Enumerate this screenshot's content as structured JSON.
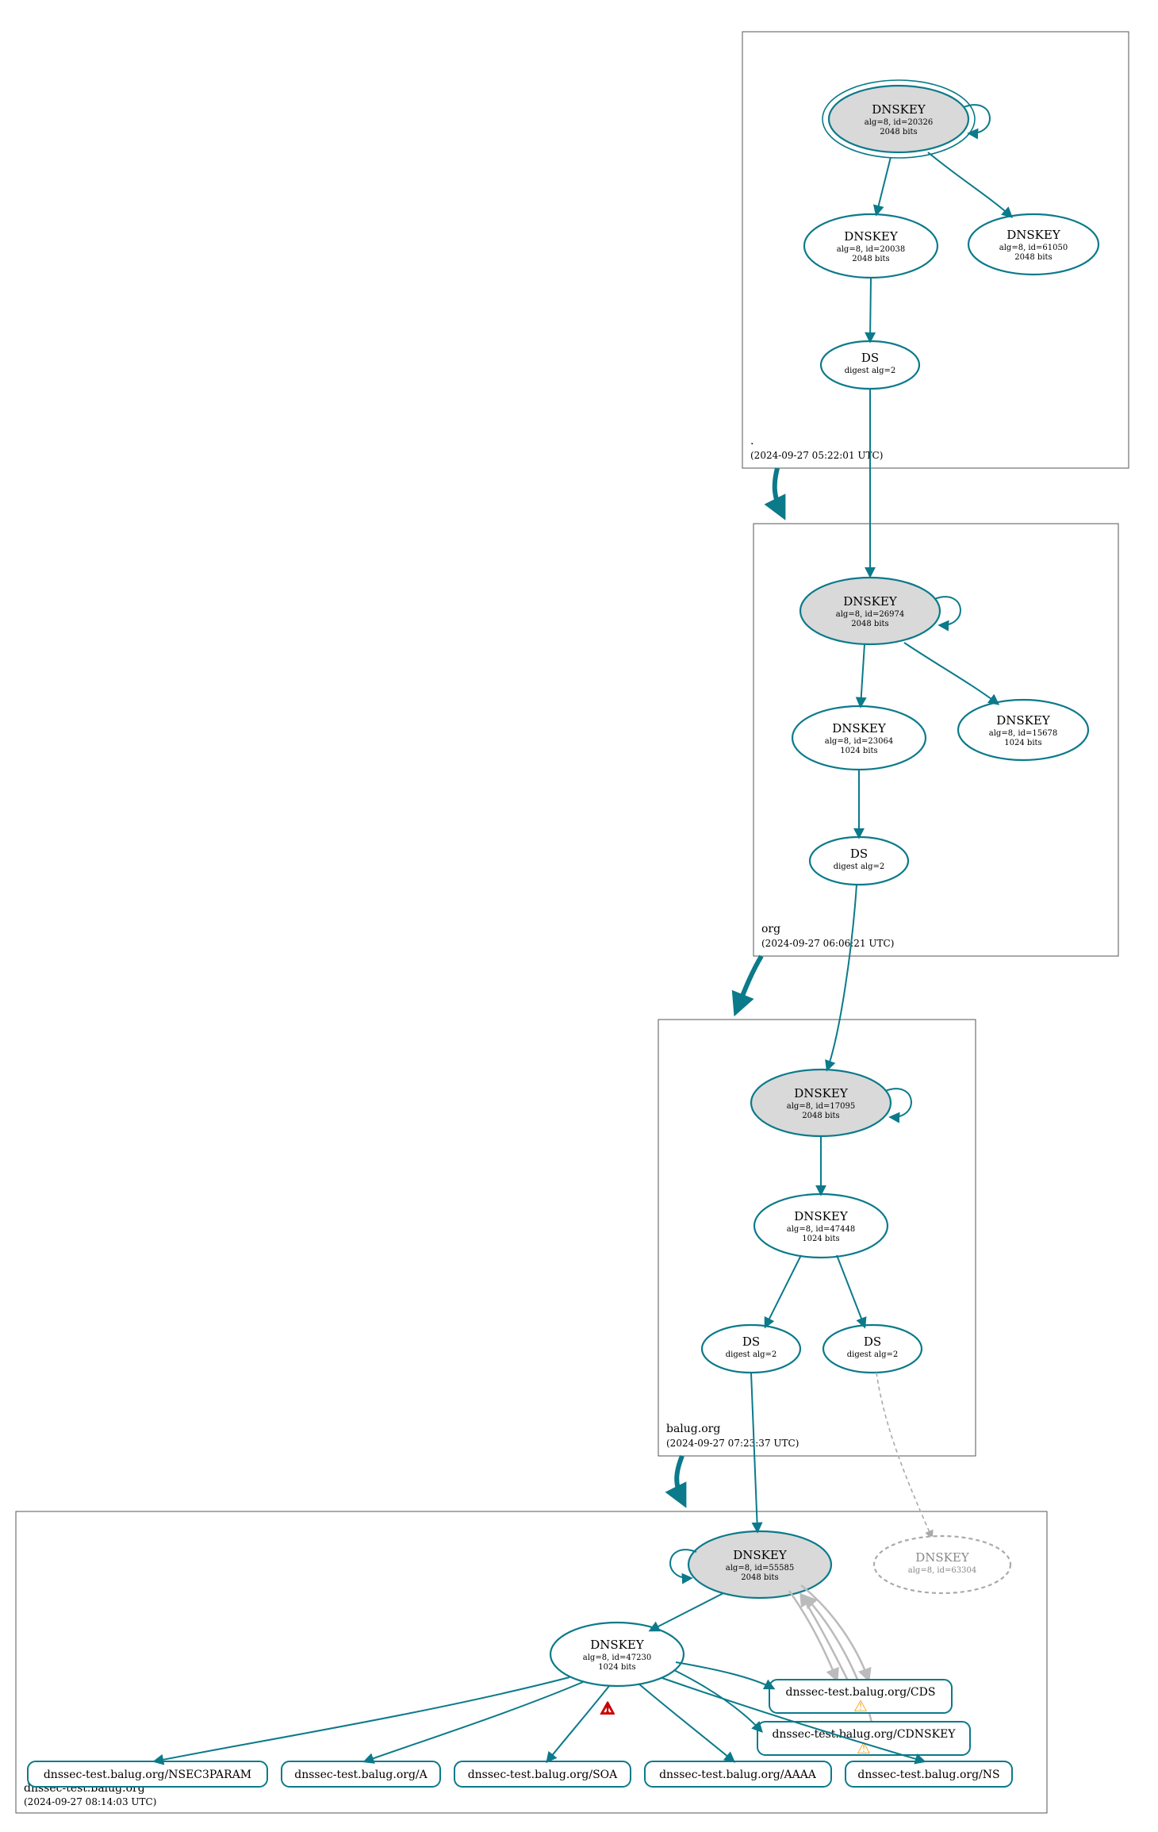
{
  "zone_root": {
    "label": ".",
    "timestamp": "(2024-09-27 05:22:01 UTC)",
    "ksk": {
      "title": "DNSKEY",
      "l2": "alg=8, id=20326",
      "l3": "2048 bits"
    },
    "zsk": {
      "title": "DNSKEY",
      "l2": "alg=8, id=20038",
      "l3": "2048 bits"
    },
    "zsk2": {
      "title": "DNSKEY",
      "l2": "alg=8, id=61050",
      "l3": "2048 bits"
    },
    "ds": {
      "title": "DS",
      "l2": "digest alg=2"
    }
  },
  "zone_org": {
    "label": "org",
    "timestamp": "(2024-09-27 06:06:21 UTC)",
    "ksk": {
      "title": "DNSKEY",
      "l2": "alg=8, id=26974",
      "l3": "2048 bits"
    },
    "zsk": {
      "title": "DNSKEY",
      "l2": "alg=8, id=23064",
      "l3": "1024 bits"
    },
    "zsk2": {
      "title": "DNSKEY",
      "l2": "alg=8, id=15678",
      "l3": "1024 bits"
    },
    "ds": {
      "title": "DS",
      "l2": "digest alg=2"
    }
  },
  "zone_balug": {
    "label": "balug.org",
    "timestamp": "(2024-09-27 07:23:37 UTC)",
    "ksk": {
      "title": "DNSKEY",
      "l2": "alg=8, id=17095",
      "l3": "2048 bits"
    },
    "zsk": {
      "title": "DNSKEY",
      "l2": "alg=8, id=47448",
      "l3": "1024 bits"
    },
    "ds1": {
      "title": "DS",
      "l2": "digest alg=2"
    },
    "ds2": {
      "title": "DS",
      "l2": "digest alg=2"
    }
  },
  "zone_dnssec": {
    "label": "dnssec-test.balug.org",
    "timestamp": "(2024-09-27 08:14:03 UTC)",
    "ksk": {
      "title": "DNSKEY",
      "l2": "alg=8, id=55585",
      "l3": "2048 bits"
    },
    "revoked": {
      "title": "DNSKEY",
      "l2": "alg=8, id=63304"
    },
    "zsk": {
      "title": "DNSKEY",
      "l2": "alg=8, id=47230",
      "l3": "1024 bits"
    },
    "rr_cds": {
      "label": "dnssec-test.balug.org/CDS"
    },
    "rr_cdnskey": {
      "label": "dnssec-test.balug.org/CDNSKEY"
    },
    "rr_nsec3": {
      "label": "dnssec-test.balug.org/NSEC3PARAM"
    },
    "rr_a": {
      "label": "dnssec-test.balug.org/A"
    },
    "rr_soa": {
      "label": "dnssec-test.balug.org/SOA"
    },
    "rr_aaaa": {
      "label": "dnssec-test.balug.org/AAAA"
    },
    "rr_ns": {
      "label": "dnssec-test.balug.org/NS"
    }
  },
  "colors": {
    "primary": "#0b7a8a",
    "ksk_fill": "#d9d9d9"
  }
}
